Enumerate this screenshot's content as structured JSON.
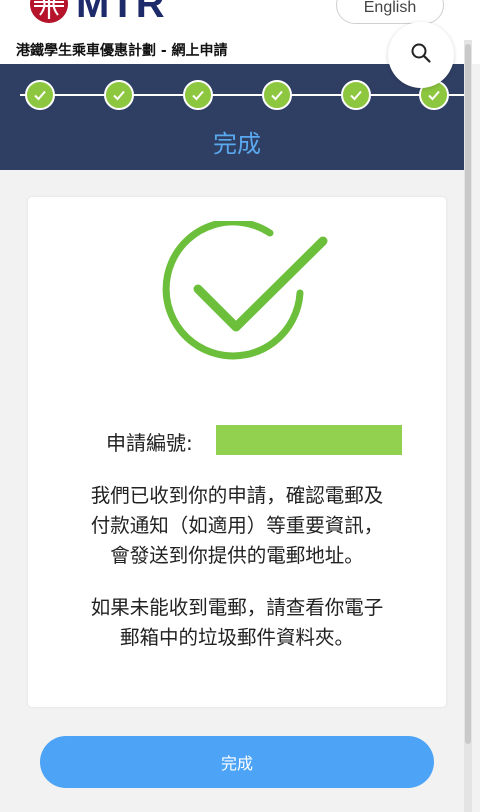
{
  "header": {
    "brand": "MTR",
    "language_button": "English",
    "page_title": "港鐵學生乘車優惠計劃 - 網上申請"
  },
  "steps": {
    "count": 6,
    "current_label": "完成",
    "colors": {
      "band": "#2f3f64",
      "done": "#8dc63f",
      "label": "#5aa8ee"
    }
  },
  "confirmation": {
    "ref_label": "申請編號:",
    "ref_value": "",
    "message_1": [
      "我們已收到你的申請，確認電郵及",
      "付款通知（如適用）等重要資訊，",
      "會發送到你提供的電郵地址。"
    ],
    "message_2": [
      "如果未能收到電郵，請查看你電子",
      "郵箱中的垃圾郵件資料夾。"
    ],
    "success_color": "#6cbf3a"
  },
  "footer": {
    "done_button": "完成",
    "button_color": "#4da3f5"
  }
}
